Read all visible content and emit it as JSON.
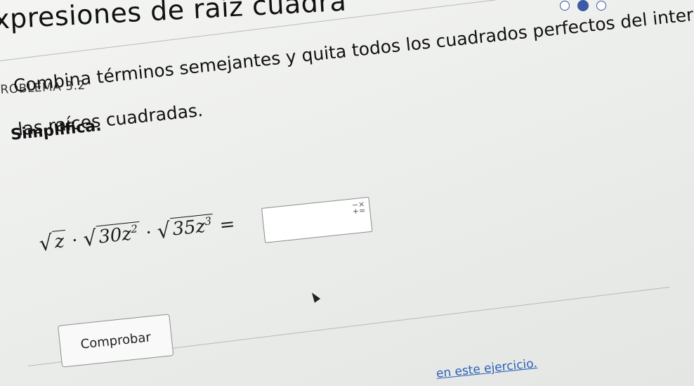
{
  "header": {
    "title": "xpresiones de raíz cuadra"
  },
  "progress": {
    "dots": [
      {
        "state": "empty"
      },
      {
        "state": "active"
      },
      {
        "state": "empty"
      }
    ]
  },
  "problem": {
    "label": "ROBLEMA 3.2",
    "heading": "Simplifica.",
    "instruction_line1": "Combina términos semejantes y quita todos los cuadrados perfectos del interior de",
    "instruction_line2": "las raíces cuadradas."
  },
  "equation": {
    "term1": "z",
    "dot1": "·",
    "term2_base": "30z",
    "term2_exp": "2",
    "dot2": "·",
    "term3_base": "35z",
    "term3_exp": "3",
    "equals": "="
  },
  "answer": {
    "value": "",
    "tool_top": "−×",
    "tool_bottom": "+="
  },
  "actions": {
    "check_label": "Comprobar"
  },
  "footer": {
    "link_text": "en este ejercicio."
  }
}
